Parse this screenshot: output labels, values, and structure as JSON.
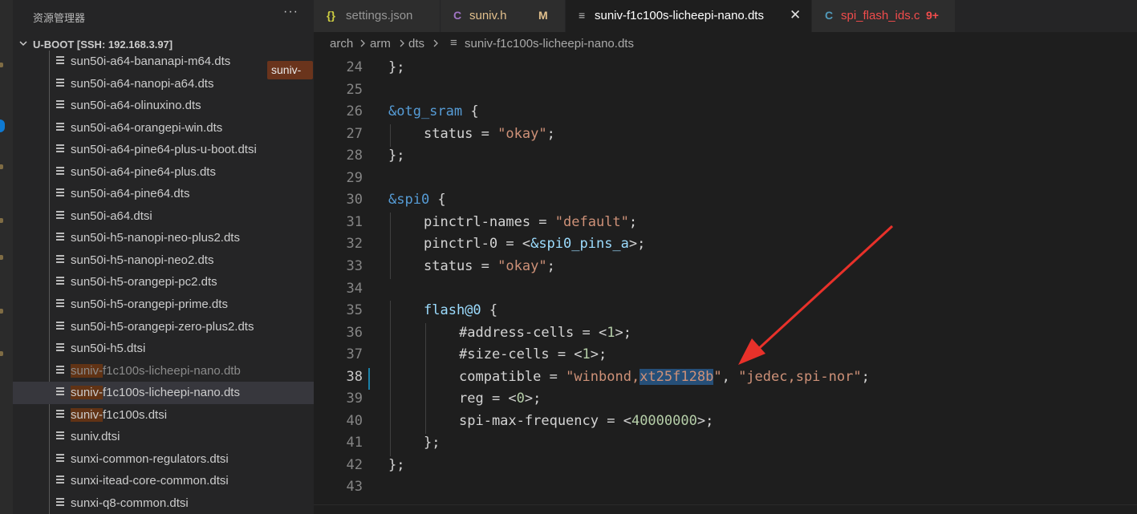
{
  "colors": {
    "accent": "#0e7ad3",
    "annotation_arrow": "#e8312a",
    "selection": "#264f78",
    "match_highlight": "#613315"
  },
  "explorer": {
    "title": "资源管理器",
    "more_icon": "ellipsis-icon",
    "section_label": "U-BOOT [SSH: 192.168.3.97]",
    "files": [
      {
        "pre": "",
        "hl": "",
        "post": "sun50i-a64-bananapi-m64.dts",
        "dim": false
      },
      {
        "pre": "",
        "hl": "",
        "post": "sun50i-a64-nanopi-a64.dts",
        "dim": false
      },
      {
        "pre": "",
        "hl": "",
        "post": "sun50i-a64-olinuxino.dts",
        "dim": false
      },
      {
        "pre": "",
        "hl": "",
        "post": "sun50i-a64-orangepi-win.dts",
        "dim": false
      },
      {
        "pre": "",
        "hl": "",
        "post": "sun50i-a64-pine64-plus-u-boot.dtsi",
        "dim": false
      },
      {
        "pre": "",
        "hl": "",
        "post": "sun50i-a64-pine64-plus.dts",
        "dim": false
      },
      {
        "pre": "",
        "hl": "",
        "post": "sun50i-a64-pine64.dts",
        "dim": false
      },
      {
        "pre": "",
        "hl": "",
        "post": "sun50i-a64.dtsi",
        "dim": false
      },
      {
        "pre": "",
        "hl": "",
        "post": "sun50i-h5-nanopi-neo-plus2.dts",
        "dim": false
      },
      {
        "pre": "",
        "hl": "",
        "post": "sun50i-h5-nanopi-neo2.dts",
        "dim": false
      },
      {
        "pre": "",
        "hl": "",
        "post": "sun50i-h5-orangepi-pc2.dts",
        "dim": false
      },
      {
        "pre": "",
        "hl": "",
        "post": "sun50i-h5-orangepi-prime.dts",
        "dim": false
      },
      {
        "pre": "",
        "hl": "",
        "post": "sun50i-h5-orangepi-zero-plus2.dts",
        "dim": false
      },
      {
        "pre": "",
        "hl": "",
        "post": "sun50i-h5.dtsi",
        "dim": false
      },
      {
        "pre": "",
        "hl": "suniv-",
        "post": "f1c100s-licheepi-nano.dtb",
        "dim": true
      },
      {
        "pre": "",
        "hl": "suniv-",
        "post": "f1c100s-licheepi-nano.dts",
        "dim": false,
        "selected": true
      },
      {
        "pre": "",
        "hl": "suniv-",
        "post": "f1c100s.dtsi",
        "dim": false
      },
      {
        "pre": "",
        "hl": "",
        "post": "suniv.dtsi",
        "dim": false
      },
      {
        "pre": "",
        "hl": "",
        "post": "sunxi-common-regulators.dtsi",
        "dim": false
      },
      {
        "pre": "",
        "hl": "",
        "post": "sunxi-itead-core-common.dtsi",
        "dim": false
      },
      {
        "pre": "",
        "hl": "",
        "post": "sunxi-q8-common.dtsi",
        "dim": false
      }
    ],
    "search_suggestion": "suniv-"
  },
  "tabs": [
    {
      "icon": "{}",
      "icon_color": "#cbcb41",
      "label": "settings.json",
      "label_color": "#969696",
      "mark": "",
      "mark_color": "",
      "active": false
    },
    {
      "icon": "C",
      "icon_color": "#a074c4",
      "label": "suniv.h",
      "label_color": "#e2c08d",
      "mark": "M",
      "mark_color": "#e2c08d",
      "active": false
    },
    {
      "icon": "≡",
      "icon_color": "#bbbbbb",
      "label": "suniv-f1c100s-licheepi-nano.dts",
      "label_color": "#ffffff",
      "mark": "",
      "mark_color": "",
      "active": true
    },
    {
      "icon": "C",
      "icon_color": "#519aba",
      "label": "spi_flash_ids.c",
      "label_color": "#f14c4c",
      "mark": "9+",
      "mark_color": "#f14c4c",
      "active": false
    }
  ],
  "breadcrumb": {
    "parts": [
      "arch",
      "arm",
      "dts"
    ],
    "file": "suniv-f1c100s-licheepi-nano.dts"
  },
  "editor": {
    "current_line": "38",
    "lines": [
      {
        "n": "24",
        "indent": 0,
        "t": [
          [
            "c-punc",
            "};"
          ]
        ]
      },
      {
        "n": "25",
        "indent": 0,
        "t": []
      },
      {
        "n": "26",
        "indent": 0,
        "t": [
          [
            "c-ref",
            "&otg_sram"
          ],
          [
            "c-punc",
            " {"
          ]
        ]
      },
      {
        "n": "27",
        "indent": 1,
        "t": [
          [
            "c-prop",
            "status"
          ],
          [
            "c-punc",
            " = "
          ],
          [
            "c-str",
            "\"okay\""
          ],
          [
            "c-punc",
            ";"
          ]
        ]
      },
      {
        "n": "28",
        "indent": 0,
        "t": [
          [
            "c-punc",
            "};"
          ]
        ]
      },
      {
        "n": "29",
        "indent": 0,
        "t": []
      },
      {
        "n": "30",
        "indent": 0,
        "t": [
          [
            "c-ref",
            "&spi0"
          ],
          [
            "c-punc",
            " {"
          ]
        ]
      },
      {
        "n": "31",
        "indent": 1,
        "t": [
          [
            "c-prop",
            "pinctrl-names"
          ],
          [
            "c-punc",
            " = "
          ],
          [
            "c-str",
            "\"default\""
          ],
          [
            "c-punc",
            ";"
          ]
        ]
      },
      {
        "n": "32",
        "indent": 1,
        "t": [
          [
            "c-prop",
            "pinctrl-0"
          ],
          [
            "c-punc",
            " = <"
          ],
          [
            "c-label",
            "&spi0_pins_a"
          ],
          [
            "c-punc",
            ">;"
          ]
        ]
      },
      {
        "n": "33",
        "indent": 1,
        "t": [
          [
            "c-prop",
            "status"
          ],
          [
            "c-punc",
            " = "
          ],
          [
            "c-str",
            "\"okay\""
          ],
          [
            "c-punc",
            ";"
          ]
        ]
      },
      {
        "n": "34",
        "indent": 0,
        "t": []
      },
      {
        "n": "35",
        "indent": 1,
        "t": [
          [
            "c-label",
            "flash@0"
          ],
          [
            "c-punc",
            " {"
          ]
        ]
      },
      {
        "n": "36",
        "indent": 2,
        "t": [
          [
            "c-prop",
            "#address-cells"
          ],
          [
            "c-punc",
            " = <"
          ],
          [
            "c-num",
            "1"
          ],
          [
            "c-punc",
            ">;"
          ]
        ]
      },
      {
        "n": "37",
        "indent": 2,
        "t": [
          [
            "c-prop",
            "#size-cells"
          ],
          [
            "c-punc",
            " = <"
          ],
          [
            "c-num",
            "1"
          ],
          [
            "c-punc",
            ">;"
          ]
        ]
      },
      {
        "n": "38",
        "indent": 2,
        "t": [
          [
            "c-prop",
            "compatible"
          ],
          [
            "c-punc",
            " = "
          ],
          [
            "c-str",
            "\"winbond,"
          ],
          [
            "c-str sel",
            "xt25f128b"
          ],
          [
            "c-str",
            "\""
          ],
          [
            "c-punc",
            ", "
          ],
          [
            "c-str",
            "\"jedec,spi-nor\""
          ],
          [
            "c-punc",
            ";"
          ]
        ]
      },
      {
        "n": "39",
        "indent": 2,
        "t": [
          [
            "c-prop",
            "reg"
          ],
          [
            "c-punc",
            " = <"
          ],
          [
            "c-num",
            "0"
          ],
          [
            "c-punc",
            ">;"
          ]
        ]
      },
      {
        "n": "40",
        "indent": 2,
        "t": [
          [
            "c-prop",
            "spi-max-frequency"
          ],
          [
            "c-punc",
            " = <"
          ],
          [
            "c-num",
            "40000000"
          ],
          [
            "c-punc",
            ">;"
          ]
        ]
      },
      {
        "n": "41",
        "indent": 1,
        "t": [
          [
            "c-punc",
            "};"
          ]
        ]
      },
      {
        "n": "42",
        "indent": 0,
        "t": [
          [
            "c-punc",
            "};"
          ]
        ]
      },
      {
        "n": "43",
        "indent": 0,
        "t": []
      }
    ]
  }
}
